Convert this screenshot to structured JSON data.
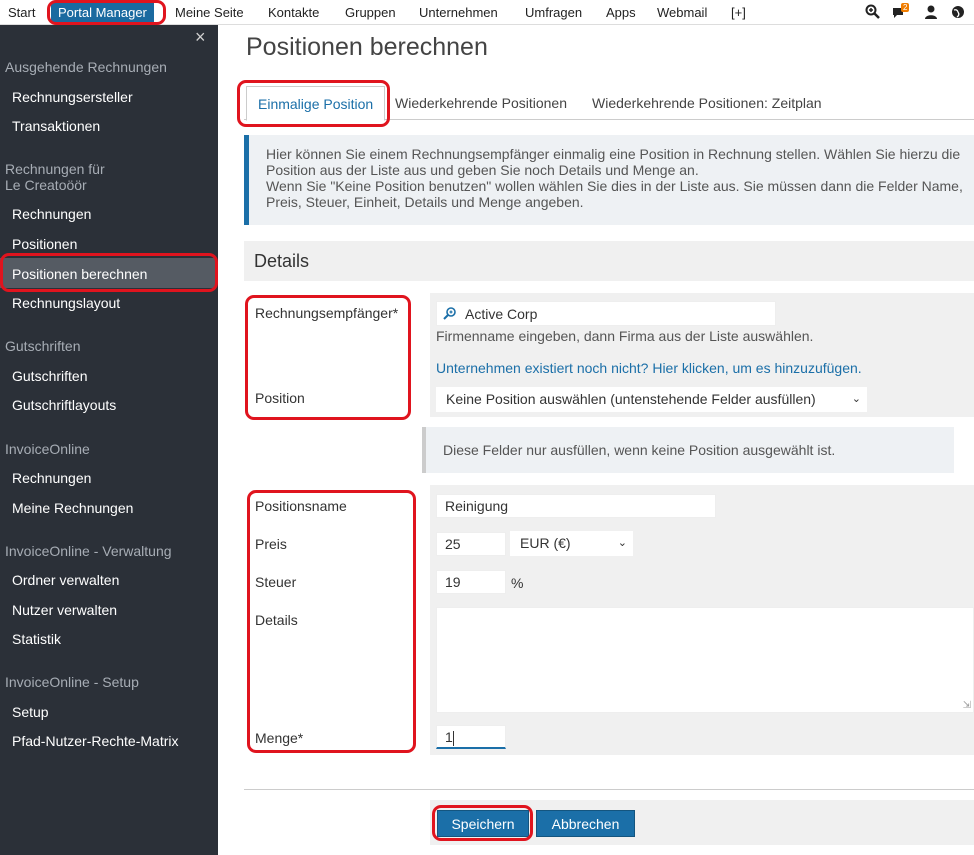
{
  "topnav": {
    "items": [
      "Start",
      "Portal Manager",
      "Meine Seite",
      "Kontakte",
      "Gruppen",
      "Unternehmen",
      "Umfragen",
      "Apps",
      "Webmail",
      "[+]"
    ],
    "notification_count": "2",
    "icons": [
      "zoom-icon",
      "chat-icon",
      "user-icon",
      "globe-icon"
    ]
  },
  "sidebar": {
    "close": "×",
    "sections": [
      {
        "title": "Ausgehende Rechnungen",
        "items": [
          "Rechnungsersteller",
          "Transaktionen"
        ]
      },
      {
        "title": "Rechnungen für\nLe Creatoöör",
        "items": [
          "Rechnungen",
          "Positionen",
          "Positionen berechnen",
          "Rechnungslayout"
        ]
      },
      {
        "title": "Gutschriften",
        "items": [
          "Gutschriften",
          "Gutschriftlayouts"
        ]
      },
      {
        "title": "InvoiceOnline",
        "items": [
          "Rechnungen",
          "Meine Rechnungen"
        ]
      },
      {
        "title": "InvoiceOnline - Verwaltung",
        "items": [
          "Ordner verwalten",
          "Nutzer verwalten",
          "Statistik"
        ]
      },
      {
        "title": "InvoiceOnline - Setup",
        "items": [
          "Setup",
          "Pfad-Nutzer-Rechte-Matrix"
        ]
      }
    ],
    "active_item": "Positionen berechnen"
  },
  "page": {
    "title": "Positionen berechnen",
    "tabs": [
      "Einmalige Position",
      "Wiederkehrende Positionen",
      "Wiederkehrende Positionen: Zeitplan"
    ],
    "info": "Hier können Sie einem Rechnungsempfänger einmalig eine Position in Rechnung stellen. Wählen Sie hierzu die Position aus der Liste aus und geben Sie noch Details und Menge an.\nWenn Sie \"Keine Position benutzen\" wollen wählen Sie dies in der Liste aus. Sie müssen dann die Felder Name, Preis, Steuer, Einheit, Details und Menge angeben.",
    "details_heading": "Details"
  },
  "form": {
    "recipient_label": "Rechnungsempfänger*",
    "recipient_value": "Active Corp",
    "recipient_hint": "Firmenname eingeben, dann Firma aus der Liste auswählen.",
    "recipient_link": "Unternehmen existiert noch nicht? Hier klicken, um es hinzuzufügen.",
    "position_label": "Position",
    "position_value": "Keine Position auswählen (untenstehende Felder ausfüllen)",
    "note": "Diese Felder nur ausfüllen, wenn keine Position ausgewählt ist.",
    "name_label": "Positionsname",
    "name_value": "Reinigung",
    "price_label": "Preis",
    "price_value": "25",
    "currency_value": "EUR (€)",
    "tax_label": "Steuer",
    "tax_value": "19",
    "tax_unit": "%",
    "details_label": "Details",
    "details_value": "",
    "quantity_label": "Menge*",
    "quantity_value": "1"
  },
  "buttons": {
    "save": "Speichern",
    "cancel": "Abbrechen"
  },
  "colors": {
    "accent": "#1b6fa8",
    "sidebar_bg": "#2b3038",
    "highlight": "#e0141e"
  }
}
